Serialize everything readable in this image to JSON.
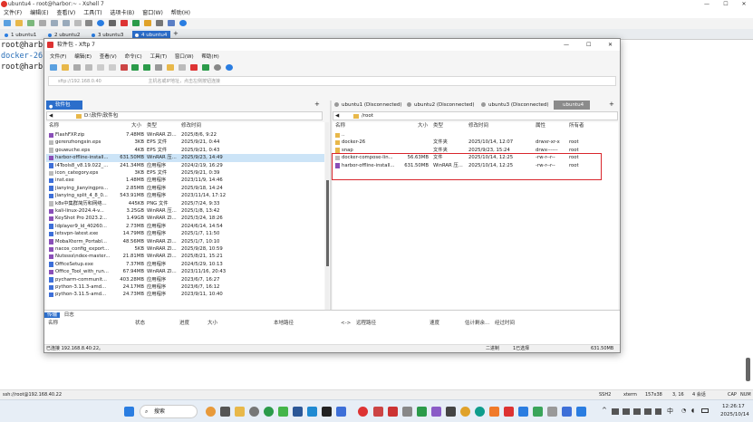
{
  "xshell": {
    "title": "ubuntu4 - root@harbor:~ - Xshell 7",
    "menu": [
      "文件(F)",
      "编辑(E)",
      "查看(V)",
      "工具(T)",
      "选项卡(B)",
      "窗口(W)",
      "帮助(H)"
    ],
    "tabs": [
      {
        "label": "1 ubuntu1"
      },
      {
        "label": "2 ubuntu2"
      },
      {
        "label": "3 ubuntu3"
      },
      {
        "label": "4 ubuntu4"
      }
    ],
    "add_tab": "+",
    "terminal_lines": [
      "root@harb",
      "docker-26",
      "root@harb"
    ],
    "status": {
      "left": "ssh://root@192.168.40.22",
      "protocol": "SSH2",
      "term": "xterm",
      "size": "157x38",
      "pos": "3, 16",
      "sessions": "4 会话",
      "caps": "CAP",
      "num": "NUM"
    }
  },
  "xftp": {
    "title": "软件包 - Xftp 7",
    "menu": [
      "文件(F)",
      "编辑(E)",
      "查看(V)",
      "命令(C)",
      "工具(T)",
      "窗口(W)",
      "帮助(H)"
    ],
    "address_placeholder": "sftp://192.168.0.40",
    "address_hint": "主机名或IP地址，点击左侧按钮连接",
    "left_tab": "软件包",
    "left_path": "D:\\软件\\软件包",
    "right_tabs": [
      "ubuntu1 (Disconnected)",
      "ubuntu2 (Disconnected)",
      "ubuntu3 (Disconnected)",
      "ubuntu4"
    ],
    "right_path": "/root",
    "left_columns": [
      "名称",
      "大小",
      "类型",
      "修改时间"
    ],
    "right_columns": [
      "名称",
      "大小",
      "类型",
      "修改时间",
      "属性",
      "所有者"
    ],
    "left_files": [
      {
        "name": "FlashFXP.zip",
        "size": "7.48MB",
        "type": "WinRAR ZI...",
        "date": "2025/8/6, 9:22"
      },
      {
        "name": "gerenzhongxin.eps",
        "size": "3KB",
        "type": "EPS 文件",
        "date": "2025/9/21, 0:44"
      },
      {
        "name": "gouwuche.eps",
        "size": "4KB",
        "type": "EPS 文件",
        "date": "2025/9/21, 0:43"
      },
      {
        "name": "harbor-offline-install...",
        "size": "631.50MB",
        "type": "WinRAR 压...",
        "date": "2025/9/23, 14:49"
      },
      {
        "name": "i4Tools8_v8.19.022_...",
        "size": "241.34MB",
        "type": "应用程序",
        "date": "2024/2/19, 16:29"
      },
      {
        "name": "icon_category.eps",
        "size": "3KB",
        "type": "EPS 文件",
        "date": "2025/9/21, 0:39"
      },
      {
        "name": "inst.exe",
        "size": "1.48MB",
        "type": "应用程序",
        "date": "2023/11/9, 14:46"
      },
      {
        "name": "jianying_jianyingpro...",
        "size": "2.85MB",
        "type": "应用程序",
        "date": "2025/9/18, 14:24"
      },
      {
        "name": "Jianying_split_4_8_0...",
        "size": "543.91MB",
        "type": "应用程序",
        "date": "2023/11/14, 17:12"
      },
      {
        "name": "k8s中集群简历和网络...",
        "size": "445KB",
        "type": "PNG 文件",
        "date": "2025/7/24, 9:33"
      },
      {
        "name": "kali-linux-2024.4-v...",
        "size": "3.25GB",
        "type": "WinRAR 压...",
        "date": "2025/1/8, 13:42"
      },
      {
        "name": "KeyShot Pro 2023.2...",
        "size": "1.49GB",
        "type": "WinRAR ZI...",
        "date": "2025/3/24, 18:26"
      },
      {
        "name": "ldplayer9_ld_40260...",
        "size": "2.73MB",
        "type": "应用程序",
        "date": "2024/6/14, 14:54"
      },
      {
        "name": "letsvpn-latest.exe",
        "size": "14.79MB",
        "type": "应用程序",
        "date": "2025/1/7, 11:50"
      },
      {
        "name": "MobaXterm_Portabl...",
        "size": "48.56MB",
        "type": "WinRAR ZI...",
        "date": "2025/1/7, 10:10"
      },
      {
        "name": "nacos_config_export...",
        "size": "5KB",
        "type": "WinRAR ZI...",
        "date": "2025/9/28, 10:59"
      },
      {
        "name": "Nutssss\\ndex-master...",
        "size": "21.81MB",
        "type": "WinRAR ZI...",
        "date": "2025/8/21, 15:21"
      },
      {
        "name": "OfficeSetup.exe",
        "size": "7.37MB",
        "type": "应用程序",
        "date": "2024/5/29, 10:13"
      },
      {
        "name": "Office_Tool_with_run...",
        "size": "67.94MB",
        "type": "WinRAR ZI...",
        "date": "2023/11/16, 20:43"
      },
      {
        "name": "pycharm-communit...",
        "size": "403.28MB",
        "type": "应用程序",
        "date": "2023/6/7, 16:27"
      },
      {
        "name": "python-3.11.3-amd...",
        "size": "24.17MB",
        "type": "应用程序",
        "date": "2023/6/7, 16:12"
      },
      {
        "name": "python-3.11.5-amd...",
        "size": "24.73MB",
        "type": "应用程序",
        "date": "2023/9/11, 10:40"
      }
    ],
    "right_files": [
      {
        "name": "..",
        "size": "",
        "type": "",
        "date": "",
        "attr": "",
        "owner": ""
      },
      {
        "name": "docker-26",
        "size": "",
        "type": "文件夹",
        "date": "2025/10/14, 12:07",
        "attr": "drwxr-xr-x",
        "owner": "root"
      },
      {
        "name": "snap",
        "size": "",
        "type": "文件夹",
        "date": "2025/9/23, 15:24",
        "attr": "drwx------",
        "owner": "root"
      },
      {
        "name": "docker-compose-lin...",
        "size": "56.63MB",
        "type": "文件",
        "date": "2025/10/14, 12:25",
        "attr": "-rw-r--r--",
        "owner": "root"
      },
      {
        "name": "harbor-offline-install...",
        "size": "631.50MB",
        "type": "WinRAR 压...",
        "date": "2025/10/14, 12:25",
        "attr": "-rw-r--r--",
        "owner": "root"
      }
    ],
    "bottom_tabs": [
      "传输",
      "日志"
    ],
    "transfer_columns": [
      "名称",
      "状态",
      "进度",
      "大小",
      "本地路径",
      "<->",
      "远程路径",
      "速度",
      "估计剩余...",
      "经过时间"
    ],
    "status": {
      "left": "已连接 192.168.8.40:22。",
      "mode": "二进制",
      "objects": "1已选择",
      "size": "631.50MB"
    }
  },
  "taskbar": {
    "search_placeholder": "搜索",
    "time": "12:26:17",
    "date": "2025/10/14",
    "lang": "中",
    "tray_up": "^"
  }
}
